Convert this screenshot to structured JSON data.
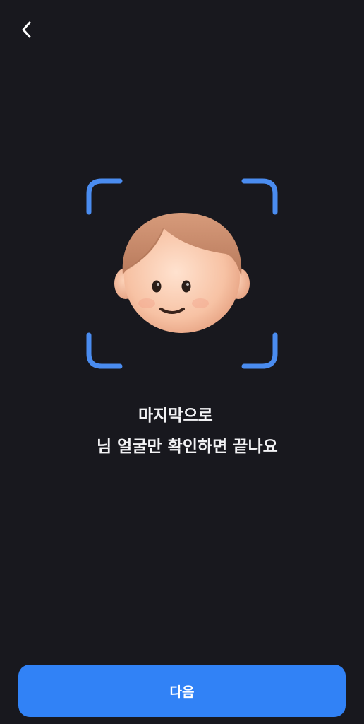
{
  "header": {
    "back_icon": "chevron-left-icon"
  },
  "scan": {
    "frame_color": "#4a8cf0",
    "avatar": "face-avatar-illustration"
  },
  "message": {
    "line1": "마지막으로",
    "line2": "님 얼굴만 확인하면 끝나요"
  },
  "footer": {
    "next_label": "다음",
    "button_color": "#3182f6"
  }
}
